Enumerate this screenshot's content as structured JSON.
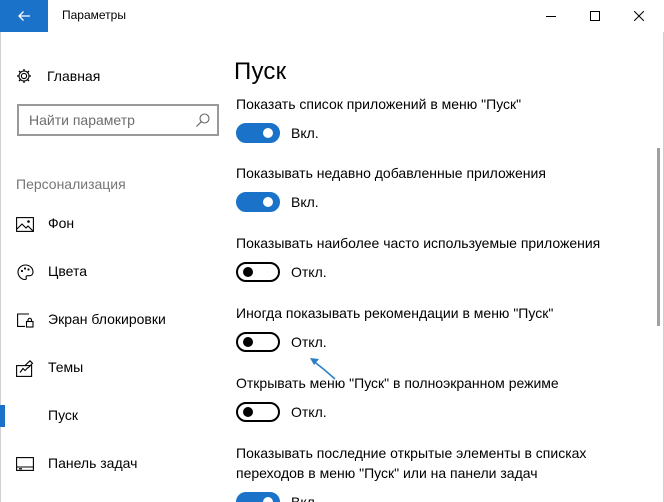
{
  "window": {
    "title": "Параметры",
    "accent_color": "#1a73c8"
  },
  "sidebar": {
    "home_label": "Главная",
    "search_placeholder": "Найти параметр",
    "section_title": "Персонализация",
    "items": [
      {
        "label": "Фон",
        "icon": "image-icon"
      },
      {
        "label": "Цвета",
        "icon": "palette-icon"
      },
      {
        "label": "Экран блокировки",
        "icon": "lock-screen-icon"
      },
      {
        "label": "Темы",
        "icon": "themes-icon"
      },
      {
        "label": "Пуск",
        "icon": "start-icon",
        "active": true
      },
      {
        "label": "Панель задач",
        "icon": "taskbar-icon"
      }
    ]
  },
  "main": {
    "title": "Пуск",
    "settings": [
      {
        "title": "Показать список приложений в меню \"Пуск\"",
        "state": "Вкл.",
        "on": true
      },
      {
        "title": "Показывать недавно добавленные приложения",
        "state": "Вкл.",
        "on": true
      },
      {
        "title": "Показывать наиболее часто используемые приложения",
        "state": "Откл.",
        "on": false
      },
      {
        "title": "Иногда показывать рекомендации в меню \"Пуск\"",
        "state": "Откл.",
        "on": false
      },
      {
        "title": "Открывать меню \"Пуск\" в полноэкранном режиме",
        "state": "Откл.",
        "on": false
      },
      {
        "title": "Показывать последние открытые элементы в списках переходов в меню \"Пуск\" или на панели задач",
        "state": "Вкл.",
        "on": true
      }
    ]
  }
}
